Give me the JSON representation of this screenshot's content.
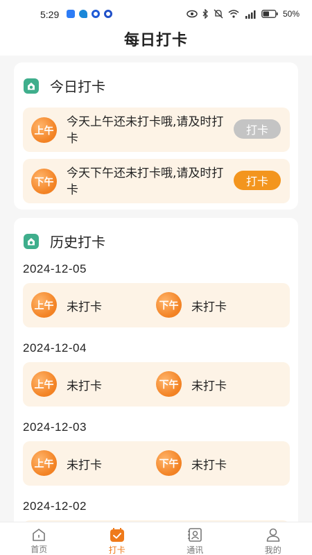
{
  "status_bar": {
    "time": "5:29",
    "battery": "50%",
    "notification_colors": [
      "#2d7cf6",
      "#1a87d8",
      "#1f5ad6",
      "#2050c8"
    ]
  },
  "header": {
    "title": "每日打卡"
  },
  "today": {
    "title": "今日打卡",
    "rows": [
      {
        "badge": "上午",
        "message": "今天上午还未打卡哦,请及时打卡",
        "button": "打卡",
        "button_state": "disabled"
      },
      {
        "badge": "下午",
        "message": "今天下午还未打卡哦,请及时打卡",
        "button": "打卡",
        "button_state": "active"
      }
    ]
  },
  "history": {
    "title": "历史打卡",
    "days": [
      {
        "date": "2024-12-05",
        "am_badge": "上午",
        "am_status": "未打卡",
        "pm_badge": "下午",
        "pm_status": "未打卡"
      },
      {
        "date": "2024-12-04",
        "am_badge": "上午",
        "am_status": "未打卡",
        "pm_badge": "下午",
        "pm_status": "未打卡"
      },
      {
        "date": "2024-12-03",
        "am_badge": "上午",
        "am_status": "未打卡",
        "pm_badge": "下午",
        "pm_status": "未打卡"
      },
      {
        "date": "2024-12-02"
      }
    ]
  },
  "tabs": [
    {
      "label": "首页",
      "icon": "home-icon",
      "active": false
    },
    {
      "label": "打卡",
      "icon": "calendar-check-icon",
      "active": true
    },
    {
      "label": "通讯",
      "icon": "contacts-icon",
      "active": false
    },
    {
      "label": "我的",
      "icon": "profile-icon",
      "active": false
    }
  ],
  "colors": {
    "accent": "#f3951e",
    "badge": "#ef7a1b",
    "section_icon": "#3fae8c",
    "row_bg": "#fdf3e6",
    "disabled_button": "#c4c4c4"
  }
}
